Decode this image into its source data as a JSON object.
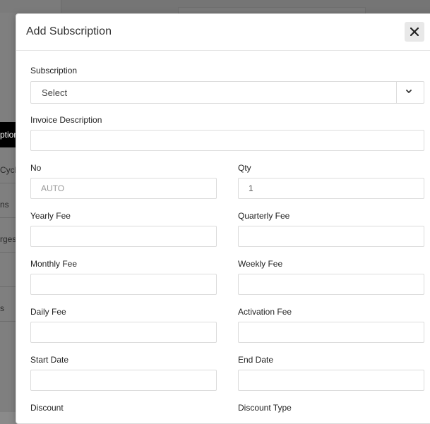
{
  "background": {
    "sidebar_active": "ption",
    "sidebar_items": [
      "Cycle",
      "ns",
      "rges",
      "",
      "s",
      ""
    ]
  },
  "modal": {
    "title": "Add Subscription",
    "close_icon": "close-icon",
    "subscription": {
      "label": "Subscription",
      "value": "Select"
    },
    "invoice_description": {
      "label": "Invoice Description",
      "value": ""
    },
    "no": {
      "label": "No",
      "placeholder": "AUTO",
      "value": ""
    },
    "qty": {
      "label": "Qty",
      "value": "1"
    },
    "yearly_fee": {
      "label": "Yearly Fee",
      "value": ""
    },
    "quarterly_fee": {
      "label": "Quarterly Fee",
      "value": ""
    },
    "monthly_fee": {
      "label": "Monthly Fee",
      "value": ""
    },
    "weekly_fee": {
      "label": "Weekly Fee",
      "value": ""
    },
    "daily_fee": {
      "label": "Daily Fee",
      "value": ""
    },
    "activation_fee": {
      "label": "Activation Fee",
      "value": ""
    },
    "start_date": {
      "label": "Start Date",
      "value": ""
    },
    "end_date": {
      "label": "End Date",
      "value": ""
    },
    "discount": {
      "label": "Discount"
    },
    "discount_type": {
      "label": "Discount Type"
    }
  }
}
